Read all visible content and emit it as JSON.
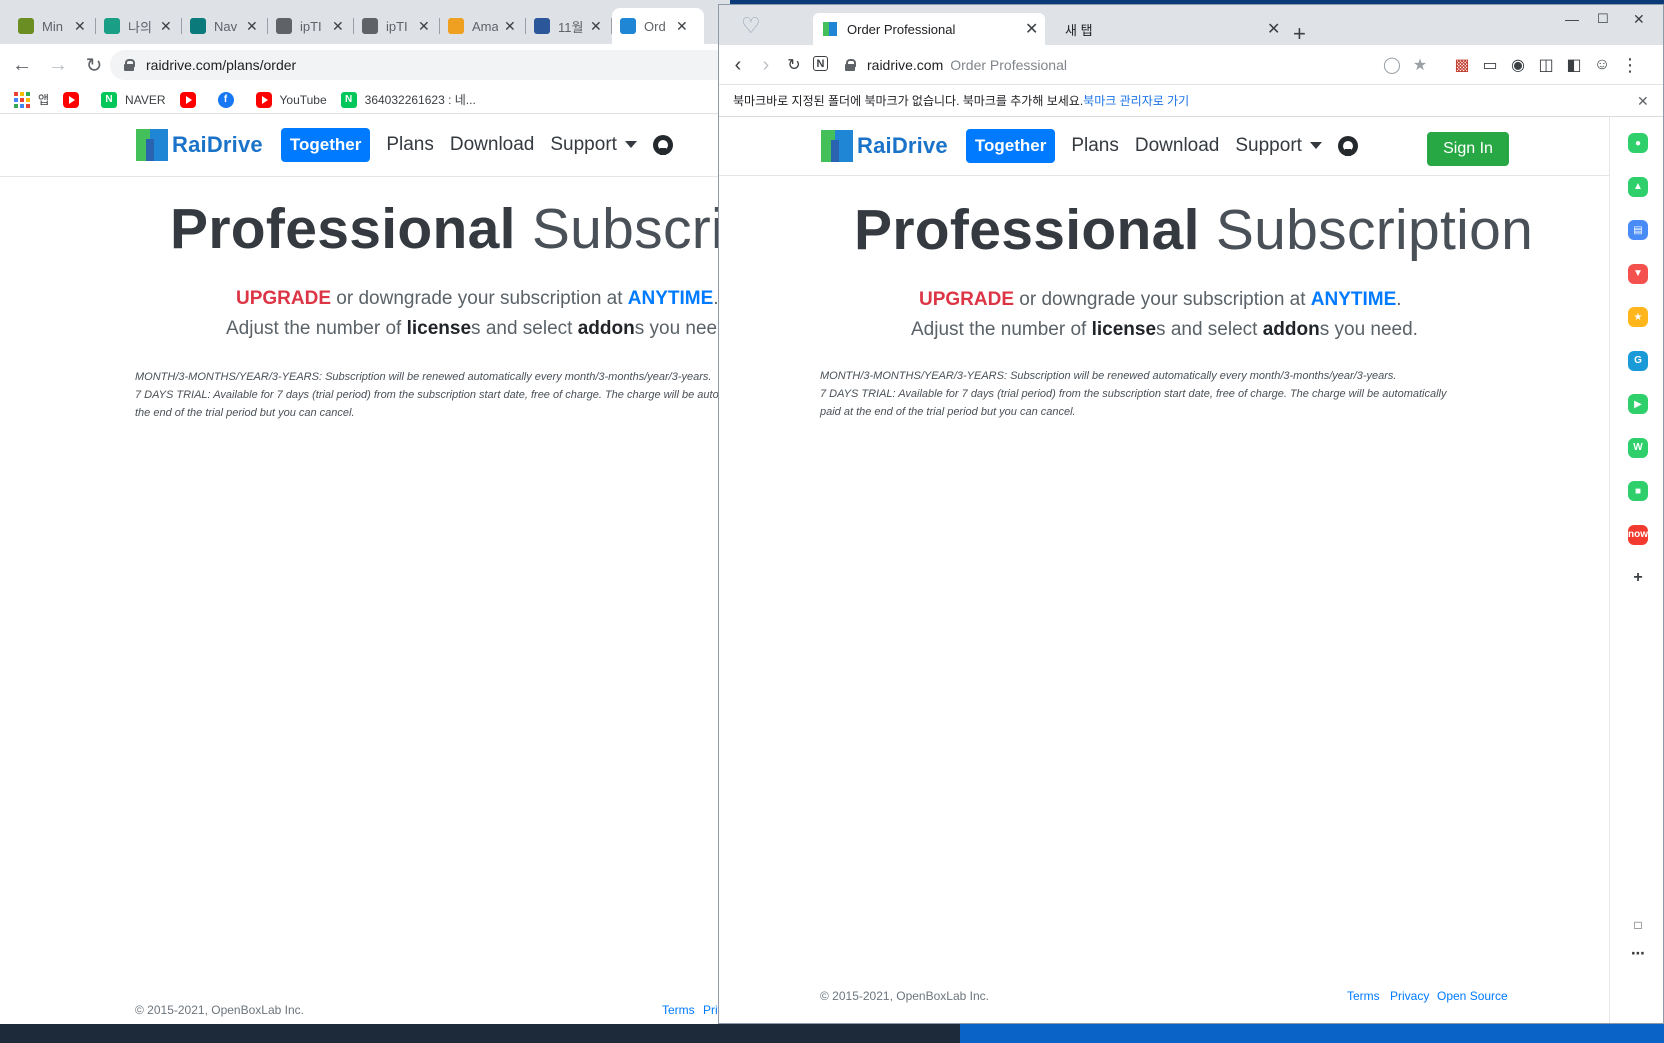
{
  "left_window": {
    "tabs": [
      {
        "title": "Min",
        "icon": "minecraft-icon",
        "color": "#6b8e23"
      },
      {
        "title": "나의",
        "icon": "h-icon",
        "color": "#1a9e85"
      },
      {
        "title": "Nav",
        "icon": "feather-icon",
        "color": "#0a7a7a"
      },
      {
        "title": "ipTI",
        "icon": "globe-icon",
        "color": "#5f6368"
      },
      {
        "title": "ipTI",
        "icon": "globe-icon",
        "color": "#5f6368"
      },
      {
        "title": "Ama",
        "icon": "amazon-icon",
        "color": "#f0a020"
      },
      {
        "title": "11월",
        "icon": "word-icon",
        "color": "#2b579a"
      },
      {
        "title": "Ord",
        "icon": "raidrive-icon",
        "color": "#1f86d6"
      }
    ],
    "url": "raidrive.com/plans/order",
    "bookmarks": [
      {
        "label": "앱",
        "icon": "apps-icon"
      },
      {
        "label": "",
        "icon": "youtube-icon"
      },
      {
        "label": "NAVER",
        "icon": "naver-icon"
      },
      {
        "label": "",
        "icon": "youtube-icon"
      },
      {
        "label": "",
        "icon": "facebook-icon"
      },
      {
        "label": "YouTube",
        "icon": "youtube-icon"
      },
      {
        "label": "364032261623 : 네...",
        "icon": "naver-icon"
      }
    ]
  },
  "right_window": {
    "tabs": [
      {
        "title": "Order Professional",
        "active": true
      },
      {
        "title": "새 탭",
        "active": false
      }
    ],
    "url_host": "raidrive.com",
    "url_title": "Order Professional",
    "infobar": {
      "message": "북마크바로 지정된 폴더에 북마크가 없습니다. 북마크를 추가해 보세요.",
      "link": "북마크 관리자로 가기"
    },
    "sign_in": "Sign In",
    "sidebar_icons": [
      "circle-icon",
      "bell-icon",
      "calendar-icon",
      "pocket-icon",
      "star-icon",
      "translate-icon",
      "play-icon",
      "webtoon-icon",
      "chat-icon",
      "now-icon",
      "plus-icon"
    ]
  },
  "site": {
    "brand": "RaiDrive",
    "nav": {
      "together": "Together",
      "plans": "Plans",
      "download": "Download",
      "support": "Support"
    },
    "hero": {
      "bold": "Professional",
      "light": "Subscription"
    },
    "lead": {
      "upgrade": "UPGRADE",
      "mid": " or downgrade your subscription at ",
      "anytime": "ANYTIME",
      "end": ".",
      "l2a": "Adjust the number of ",
      "license": "license",
      "l2b": "s and select ",
      "addon": "addon",
      "l2c": "s you need."
    },
    "notes": {
      "n1_label": "MONTH/3-MONTHS/YEAR/3-YEARS",
      "n1_text": ": Subscription will be renewed automatically every month/3-months/year/3-years.",
      "n2_label": "7 DAYS TRIAL",
      "n2_text": ": Available for 7 days (trial period) from the subscription start date, free of charge. The charge will be automatically paid at the end of the trial period but you can cancel."
    },
    "footer": {
      "copyright": "© 2015-2021, OpenBoxLab Inc.",
      "terms": "Terms",
      "privacy": "Privacy",
      "open_source": "Open Source"
    }
  }
}
